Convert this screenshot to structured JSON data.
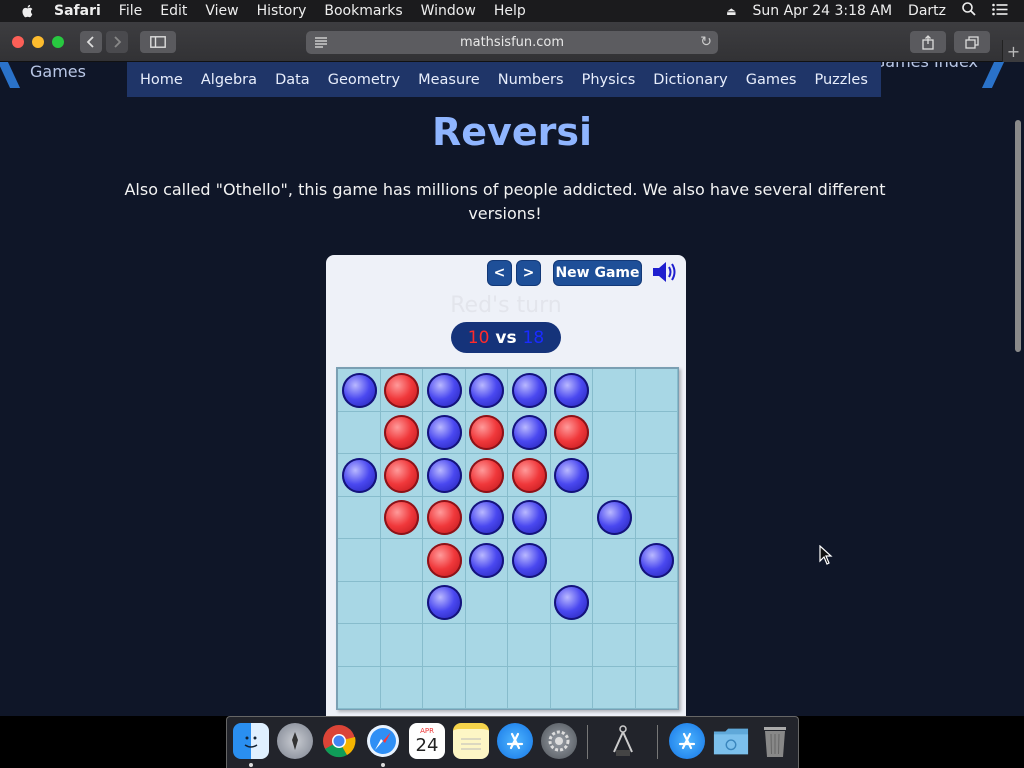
{
  "menubar": {
    "app": "Safari",
    "items": [
      "File",
      "Edit",
      "View",
      "History",
      "Bookmarks",
      "Window",
      "Help"
    ],
    "datetime": "Sun Apr 24  3:18 AM",
    "user": "Dartz"
  },
  "browser": {
    "url": "mathsisfun.com"
  },
  "site": {
    "games_link": "Games",
    "games_index": "Games Index",
    "nav": [
      "Home",
      "Algebra",
      "Data",
      "Geometry",
      "Measure",
      "Numbers",
      "Physics",
      "Dictionary",
      "Games",
      "Puzzles"
    ],
    "title": "Reversi",
    "intro": "Also called \"Othello\", this game has millions of people addicted. We also have several different versions!"
  },
  "game": {
    "prev_label": "<",
    "next_label": ">",
    "new_game_label": "New Game",
    "turn_text": "Red's turn",
    "score_red": "10",
    "score_vs": "vs",
    "score_blue": "18",
    "board": [
      [
        "B",
        "R",
        "B",
        "B",
        "B",
        "B",
        "",
        ""
      ],
      [
        "",
        "R",
        "B",
        "R",
        "B",
        "R",
        "",
        ""
      ],
      [
        "B",
        "R",
        "B",
        "R",
        "R",
        "B",
        "",
        ""
      ],
      [
        "",
        "R",
        "R",
        "B",
        "B",
        "",
        "B",
        ""
      ],
      [
        "",
        "",
        "R",
        "B",
        "B",
        "",
        "",
        "B"
      ],
      [
        "",
        "",
        "B",
        "",
        "",
        "B",
        "",
        ""
      ],
      [
        "",
        "",
        "",
        "",
        "",
        "",
        "",
        ""
      ],
      [
        "",
        "",
        "",
        "",
        "",
        "",
        "",
        ""
      ]
    ],
    "colors": {
      "red": "#f0383b",
      "blue": "#4a48f0",
      "board": "#a8d7e5"
    }
  },
  "dock": {
    "apps": [
      "Finder",
      "Launchpad",
      "Chrome",
      "Safari",
      "Calendar",
      "Notes",
      "App Store",
      "System Preferences",
      "Utility",
      "App Store Folder",
      "Downloads",
      "Trash"
    ],
    "calendar_month": "APR",
    "calendar_day": "24"
  }
}
